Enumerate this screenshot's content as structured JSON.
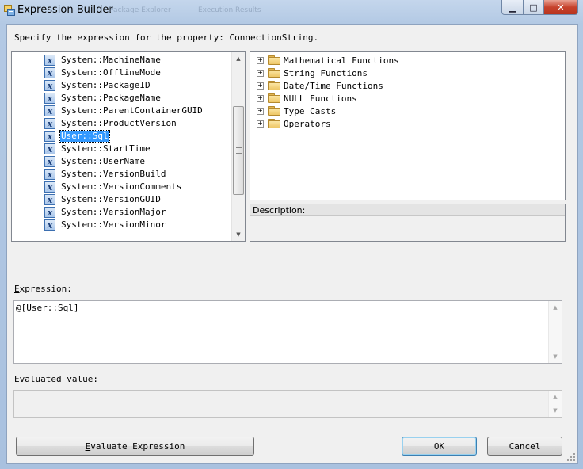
{
  "window": {
    "title": "Expression Builder",
    "ghost_tabs": [
      "Package Explorer",
      "Execution Results"
    ],
    "controls": {
      "minimize": "▁",
      "maximize": "□",
      "close": "✕"
    }
  },
  "prompt": "Specify the expression for the property: ConnectionString.",
  "variables": {
    "items": [
      "System::MachineName",
      "System::OfflineMode",
      "System::PackageID",
      "System::PackageName",
      "System::ParentContainerGUID",
      "System::ProductVersion",
      "User::Sql",
      "System::StartTime",
      "System::UserName",
      "System::VersionBuild",
      "System::VersionComments",
      "System::VersionGUID",
      "System::VersionMajor",
      "System::VersionMinor"
    ],
    "selected_index": 6,
    "icon_glyph": "x",
    "scroll_position": 0.55
  },
  "functions": {
    "nodes": [
      "Mathematical Functions",
      "String Functions",
      "Date/Time Functions",
      "NULL Functions",
      "Type Casts",
      "Operators"
    ],
    "expander": "+"
  },
  "description": {
    "label": "Description:"
  },
  "expression": {
    "label_access_key": "E",
    "label_rest": "xpression:",
    "value": "@[User::Sql]"
  },
  "evaluated": {
    "label": "Evaluated value:",
    "value": ""
  },
  "buttons": {
    "evaluate_access_key": "E",
    "evaluate_rest": "valuate Expression",
    "ok": "OK",
    "cancel": "Cancel"
  },
  "colors": {
    "selection": "#3399ff",
    "title_gradient": "#b3c9e4",
    "dialog_bg": "#f0f0f0",
    "close_button": "#c7432d"
  },
  "icons": {
    "title": "expression-builder-icon",
    "variable": "variable-x-icon",
    "folder": "folder-icon",
    "expand": "plus-box-icon",
    "scroll_up": "scroll-up-arrow-icon",
    "scroll_down": "scroll-down-arrow-icon",
    "size_grip": "size-grip-icon"
  }
}
